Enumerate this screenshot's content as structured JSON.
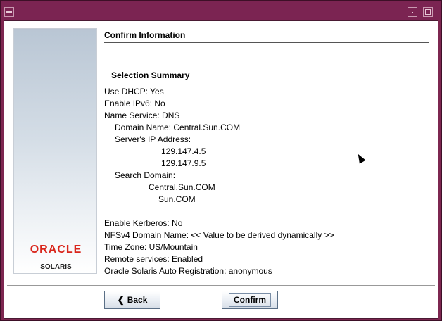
{
  "window": {
    "controls": {
      "menu_icon": "window-menu-icon",
      "minimize_icon": "minimize-icon",
      "maximize_icon": "maximize-icon"
    }
  },
  "sidebar": {
    "brand": "ORACLE",
    "product": "SOLARIS"
  },
  "page": {
    "title": "Confirm Information",
    "heading": "Selection Summary",
    "lines": [
      "Use DHCP: Yes",
      "Enable IPv6: No",
      "Name Service: DNS",
      "Domain Name: Central.Sun.COM",
      "Server's IP Address:",
      "129.147.4.5",
      "129.147.9.5",
      "Search Domain:",
      "Central.Sun.COM",
      "Sun.COM",
      "Enable Kerberos: No",
      "NFSv4 Domain Name: << Value to be derived dynamically >>",
      "Time Zone: US/Mountain",
      "Remote services: Enabled",
      "Oracle Solaris Auto Registration: anonymous"
    ]
  },
  "buttons": {
    "back": "Back",
    "confirm": "Confirm"
  },
  "colors": {
    "frame": "#7b2452",
    "logo_red": "#d9261c"
  }
}
